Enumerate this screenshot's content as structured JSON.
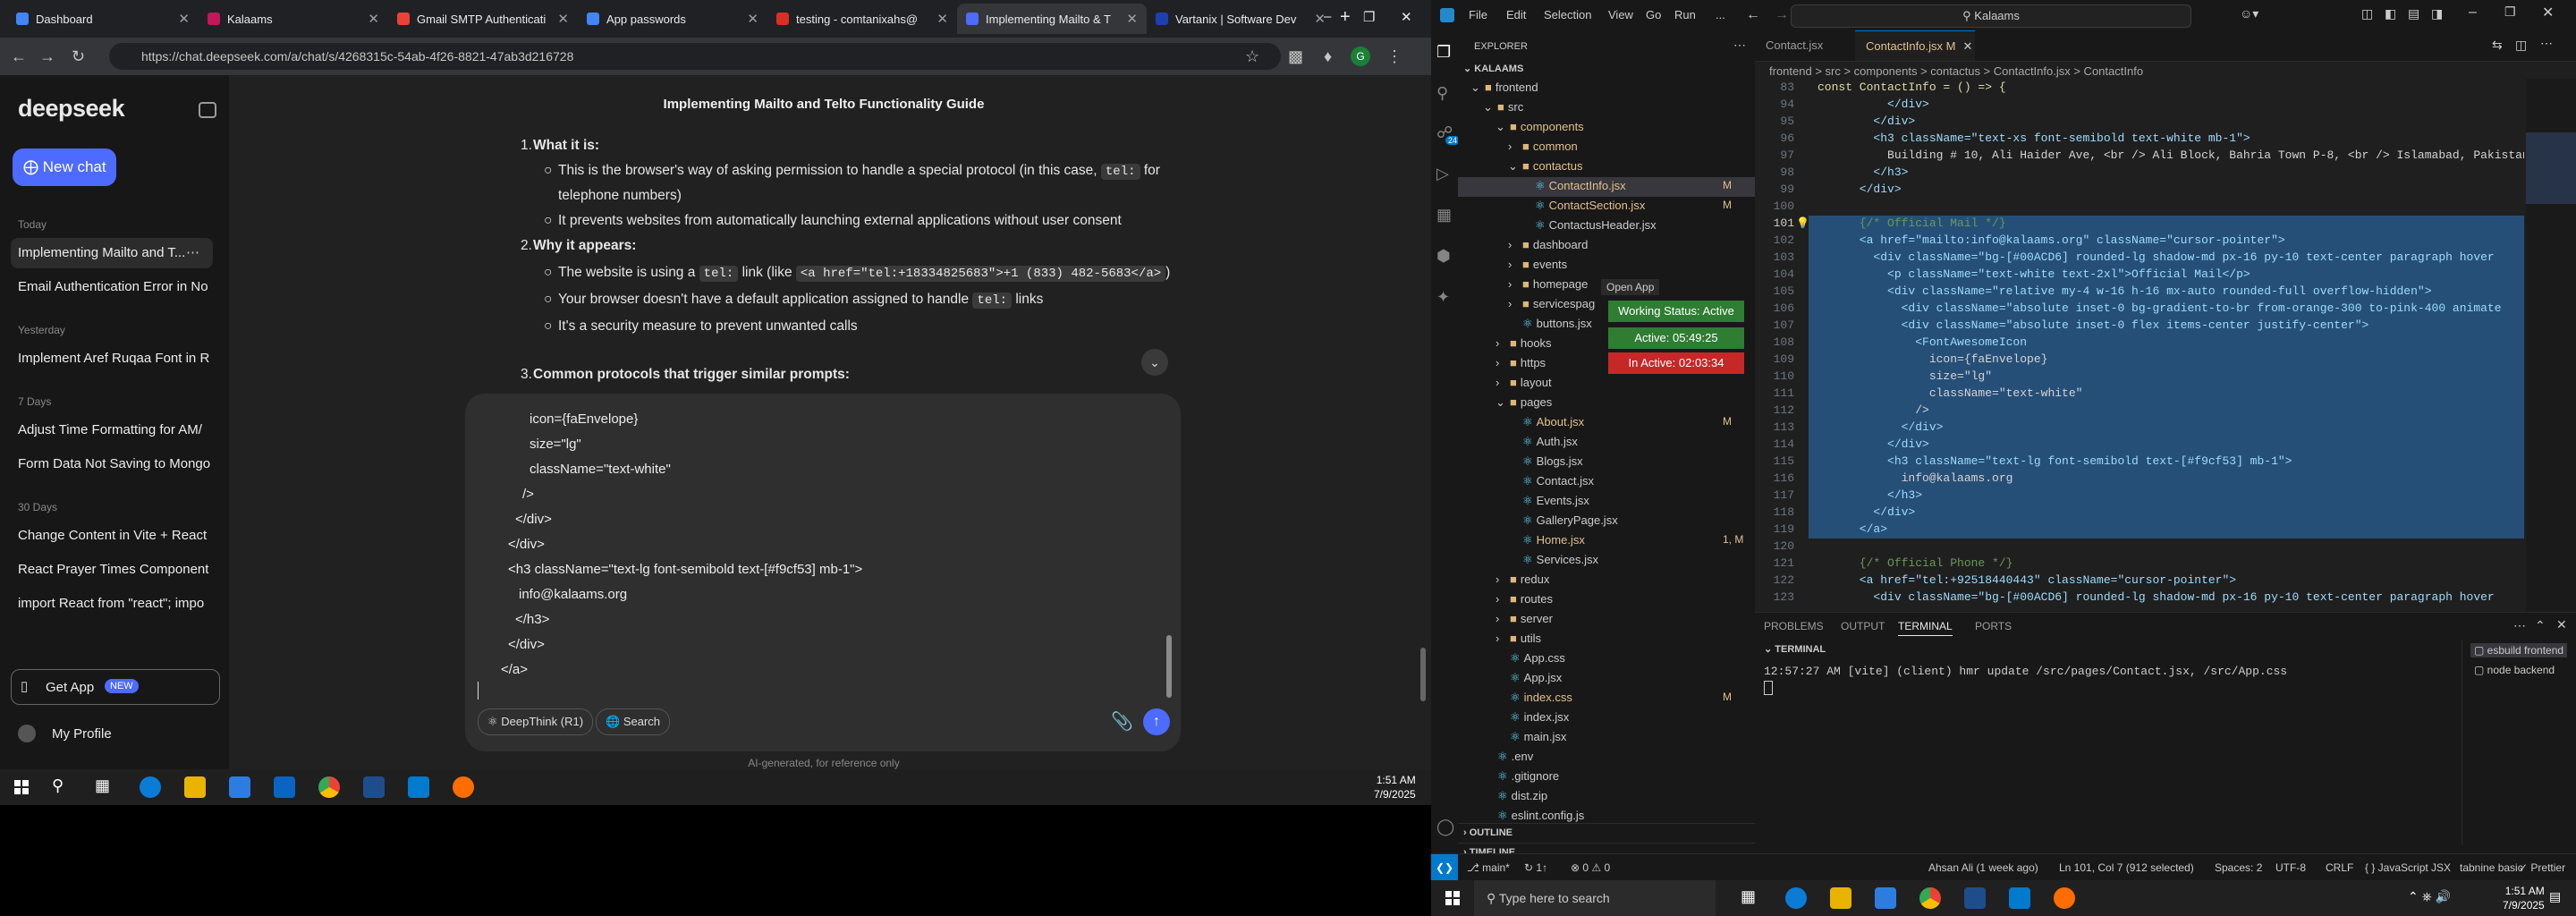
{
  "browser": {
    "tabs": [
      {
        "title": "Dashboard",
        "color": "#4285f4"
      },
      {
        "title": "Kalaams",
        "color": "#c2185b"
      },
      {
        "title": "Gmail SMTP Authenticati",
        "color": "#ea4335"
      },
      {
        "title": "App passwords",
        "color": "#4285f4"
      },
      {
        "title": "testing - comtanixahs@",
        "color": "#d93025"
      },
      {
        "title": "Implementing Mailto & T",
        "color": "#4d6bfe",
        "active": true
      },
      {
        "title": "Vartanix | Software Dev",
        "color": "#1e40af"
      }
    ],
    "url": "https://chat.deepseek.com/a/chat/s/4268315c-54ab-4f26-8821-47ab3d216728"
  },
  "deepseek": {
    "logo": "deepseek",
    "new_chat": "New chat",
    "groups": [
      {
        "label": "Today",
        "items": [
          "Implementing Mailto and T...",
          "Email Authentication Error in No"
        ]
      },
      {
        "label": "Yesterday",
        "items": [
          "Implement Aref Ruqaa Font in R"
        ]
      },
      {
        "label": "7 Days",
        "items": [
          "Adjust Time Formatting for AM/",
          "Form Data Not Saving to Mongo"
        ]
      },
      {
        "label": "30 Days",
        "items": [
          "Change Content in Vite + React",
          "React Prayer Times Component",
          "import React from \"react\"; impo"
        ]
      }
    ],
    "get_app": "Get App",
    "new_badge": "NEW",
    "profile": "My Profile",
    "chat_title": "Implementing Mailto and Telto Functionality Guide",
    "answer": {
      "item1_num": "1.",
      "item1_title": "What it is:",
      "b1a_pre": "This is the browser's way of asking permission to handle a special protocol (in this case,",
      "b1a_code": "tel:",
      "b1a_post": "for",
      "b1a_cont": "telephone numbers)",
      "b1b": "It prevents websites from automatically launching external applications without user consent",
      "item2_num": "2.",
      "item2_title": "Why it appears:",
      "b2a_pre": "The website is using a",
      "b2a_code": "tel:",
      "b2a_mid": "link (like",
      "b2a_code2": "<a href=\"tel:+18334825683\">+1 (833) 482-5683</a>",
      "b2a_post": ")",
      "b2b_pre": "Your browser doesn't have a default application assigned to handle",
      "b2b_code": "tel:",
      "b2b_post": "links",
      "b2c": "It's a security measure to prevent unwanted calls",
      "item3_num": "3.",
      "item3_title": "Common protocols that trigger similar prompts:"
    },
    "composer_lines": [
      "icon={faEnvelope}",
      "size=\"lg\"",
      "className=\"text-white\"",
      "/>",
      "</div>",
      "</div>",
      "<h3 className=\"text-lg font-semibold text-[#f9cf53] mb-1\">",
      "info@kalaams.org",
      "</h3>",
      "</div>",
      "</a>"
    ],
    "deepthink": "DeepThink (R1)",
    "search": "Search",
    "disclaimer": "AI-generated, for reference only"
  },
  "taskbar1": {
    "time": "1:51 AM",
    "date": "7/9/2025"
  },
  "vscode": {
    "menu": [
      "File",
      "Edit",
      "Selection",
      "View",
      "Go",
      "Run",
      "..."
    ],
    "search": "Kalaams",
    "explorer_title": "EXPLORER",
    "root": "KALAAMS",
    "tree": [
      {
        "name": "frontend",
        "type": "folder",
        "open": true,
        "depth": 0
      },
      {
        "name": "src",
        "type": "folder",
        "open": true,
        "depth": 1
      },
      {
        "name": "components",
        "type": "folder",
        "open": true,
        "depth": 2,
        "color": "#e2c08d"
      },
      {
        "name": "common",
        "type": "folder",
        "open": false,
        "depth": 3,
        "color": "#e2c08d"
      },
      {
        "name": "contactus",
        "type": "folder",
        "open": true,
        "depth": 3,
        "color": "#e2c08d"
      },
      {
        "name": "ContactInfo.jsx",
        "type": "file",
        "depth": 4,
        "badge": "M",
        "color": "#e2c08d",
        "selected": true
      },
      {
        "name": "ContactSection.jsx",
        "type": "file",
        "depth": 4,
        "badge": "M",
        "color": "#e2c08d"
      },
      {
        "name": "ContactusHeader.jsx",
        "type": "file",
        "depth": 4
      },
      {
        "name": "dashboard",
        "type": "folder",
        "open": false,
        "depth": 3
      },
      {
        "name": "events",
        "type": "folder",
        "open": false,
        "depth": 3
      },
      {
        "name": "homepage",
        "type": "folder",
        "open": false,
        "depth": 3
      },
      {
        "name": "servicespag",
        "type": "folder",
        "open": false,
        "depth": 3
      },
      {
        "name": "buttons.jsx",
        "type": "file",
        "depth": 3
      },
      {
        "name": "hooks",
        "type": "folder",
        "open": false,
        "depth": 2
      },
      {
        "name": "https",
        "type": "folder",
        "open": false,
        "depth": 2
      },
      {
        "name": "layout",
        "type": "folder",
        "open": false,
        "depth": 2
      },
      {
        "name": "pages",
        "type": "folder",
        "open": true,
        "depth": 2
      },
      {
        "name": "About.jsx",
        "type": "file",
        "depth": 3,
        "badge": "M",
        "color": "#e2c08d"
      },
      {
        "name": "Auth.jsx",
        "type": "file",
        "depth": 3
      },
      {
        "name": "Blogs.jsx",
        "type": "file",
        "depth": 3
      },
      {
        "name": "Contact.jsx",
        "type": "file",
        "depth": 3
      },
      {
        "name": "Events.jsx",
        "type": "file",
        "depth": 3
      },
      {
        "name": "GalleryPage.jsx",
        "type": "file",
        "depth": 3
      },
      {
        "name": "Home.jsx",
        "type": "file",
        "depth": 3,
        "badge": "1, M",
        "color": "#e2c08d"
      },
      {
        "name": "Services.jsx",
        "type": "file",
        "depth": 3
      },
      {
        "name": "redux",
        "type": "folder",
        "open": false,
        "depth": 2
      },
      {
        "name": "routes",
        "type": "folder",
        "open": false,
        "depth": 2
      },
      {
        "name": "server",
        "type": "folder",
        "open": false,
        "depth": 2
      },
      {
        "name": "utils",
        "type": "folder",
        "open": false,
        "depth": 2
      },
      {
        "name": "App.css",
        "type": "file",
        "depth": 2
      },
      {
        "name": "App.jsx",
        "type": "file",
        "depth": 2
      },
      {
        "name": "index.css",
        "type": "file",
        "depth": 2,
        "badge": "M",
        "color": "#e2c08d"
      },
      {
        "name": "index.jsx",
        "type": "file",
        "depth": 2
      },
      {
        "name": "main.jsx",
        "type": "file",
        "depth": 2
      },
      {
        "name": ".env",
        "type": "file",
        "depth": 1
      },
      {
        "name": ".gitignore",
        "type": "file",
        "depth": 1
      },
      {
        "name": "dist.zip",
        "type": "file",
        "depth": 1
      },
      {
        "name": "eslint.config.js",
        "type": "file",
        "depth": 1
      }
    ],
    "outline": "OUTLINE",
    "timeline": "TIMELINE",
    "editor_tabs": [
      {
        "name": "Contact.jsx",
        "active": false
      },
      {
        "name": "ContactInfo.jsx M",
        "active": true
      }
    ],
    "breadcrumb": "frontend > src > components > contactus > ContactInfo.jsx > ContactInfo",
    "code_lines": [
      {
        "n": "83",
        "t": "const ContactInfo = () => {"
      },
      {
        "n": "94",
        "t": "          </div>"
      },
      {
        "n": "95",
        "t": "        </div>"
      },
      {
        "n": "96",
        "t": "        <h3 className=\"text-xs font-semibold text-white mb-1\">"
      },
      {
        "n": "97",
        "t": "          Building # 10, Ali Haider Ave, <br /> Ali Block, Bahria Town P-8, <br /> Islamabad, Pakistan"
      },
      {
        "n": "98",
        "t": "        </h3>"
      },
      {
        "n": "99",
        "t": "      </div>"
      },
      {
        "n": "100",
        "t": ""
      },
      {
        "n": "101",
        "t": "      {/* Official Mail */}",
        "sel": true
      },
      {
        "n": "102",
        "t": "      <a href=\"mailto:info@kalaams.org\" className=\"cursor-pointer\">",
        "sel": true
      },
      {
        "n": "103",
        "t": "        <div className=\"bg-[#00ACD6] rounded-lg shadow-md px-16 py-10 text-center paragraph hover",
        "sel": true
      },
      {
        "n": "104",
        "t": "          <p className=\"text-white text-2xl\">Official Mail</p>",
        "sel": true
      },
      {
        "n": "105",
        "t": "          <div className=\"relative my-4 w-16 h-16 mx-auto rounded-full overflow-hidden\">",
        "sel": true
      },
      {
        "n": "106",
        "t": "            <div className=\"absolute inset-0 bg-gradient-to-br from-orange-300 to-pink-400 animate",
        "sel": true
      },
      {
        "n": "107",
        "t": "            <div className=\"absolute inset-0 flex items-center justify-center\">",
        "sel": true
      },
      {
        "n": "108",
        "t": "              <FontAwesomeIcon",
        "sel": true
      },
      {
        "n": "109",
        "t": "                icon={faEnvelope}",
        "sel": true
      },
      {
        "n": "110",
        "t": "                size=\"lg\"",
        "sel": true
      },
      {
        "n": "111",
        "t": "                className=\"text-white\"",
        "sel": true
      },
      {
        "n": "112",
        "t": "              />",
        "sel": true
      },
      {
        "n": "113",
        "t": "            </div>",
        "sel": true
      },
      {
        "n": "114",
        "t": "          </div>",
        "sel": true
      },
      {
        "n": "115",
        "t": "          <h3 className=\"text-lg font-semibold text-[#f9cf53] mb-1\">",
        "sel": true
      },
      {
        "n": "116",
        "t": "            info@kalaams.org",
        "sel": true
      },
      {
        "n": "117",
        "t": "          </h3>",
        "sel": true
      },
      {
        "n": "118",
        "t": "        </div>",
        "sel": true
      },
      {
        "n": "119",
        "t": "      </a>",
        "sel": true
      },
      {
        "n": "120",
        "t": ""
      },
      {
        "n": "121",
        "t": "      {/* Official Phone */}"
      },
      {
        "n": "122",
        "t": "      <a href=\"tel:+92518440443\" className=\"cursor-pointer\">"
      },
      {
        "n": "123",
        "t": "        <div className=\"bg-[#00ACD6] rounded-lg shadow-md px-16 py-10 text-center paragraph hover"
      }
    ],
    "overlay": {
      "open_app": "Open App",
      "working": "Working Status: Active",
      "active": "Active: 05:49:25",
      "inactive": "In Active: 02:03:34"
    },
    "panel_tabs": [
      "PROBLEMS",
      "OUTPUT",
      "TERMINAL",
      "PORTS"
    ],
    "terminal_title": "TERMINAL",
    "terminal_line": "12:57:27 AM [vite] (client) hmr update /src/pages/Contact.jsx, /src/App.css",
    "terminals": [
      "esbuild frontend",
      "node backend"
    ],
    "status": {
      "branch": "main*",
      "sync": "↻ 1↑",
      "errors": "⊗ 0 ⚠ 0",
      "blame": "Ahsan Ali (1 week ago)",
      "pos": "Ln 101, Col 7 (912 selected)",
      "spaces": "Spaces: 2",
      "enc": "UTF-8",
      "eol": "CRLF",
      "lang": "{ } JavaScript JSX",
      "tabnine": "tabnine basic",
      "prettier": "✓ Prettier"
    },
    "activity_badge": "24"
  },
  "taskbar2": {
    "search": "Type here to search",
    "time": "1:51 AM",
    "date": "7/9/2025"
  }
}
